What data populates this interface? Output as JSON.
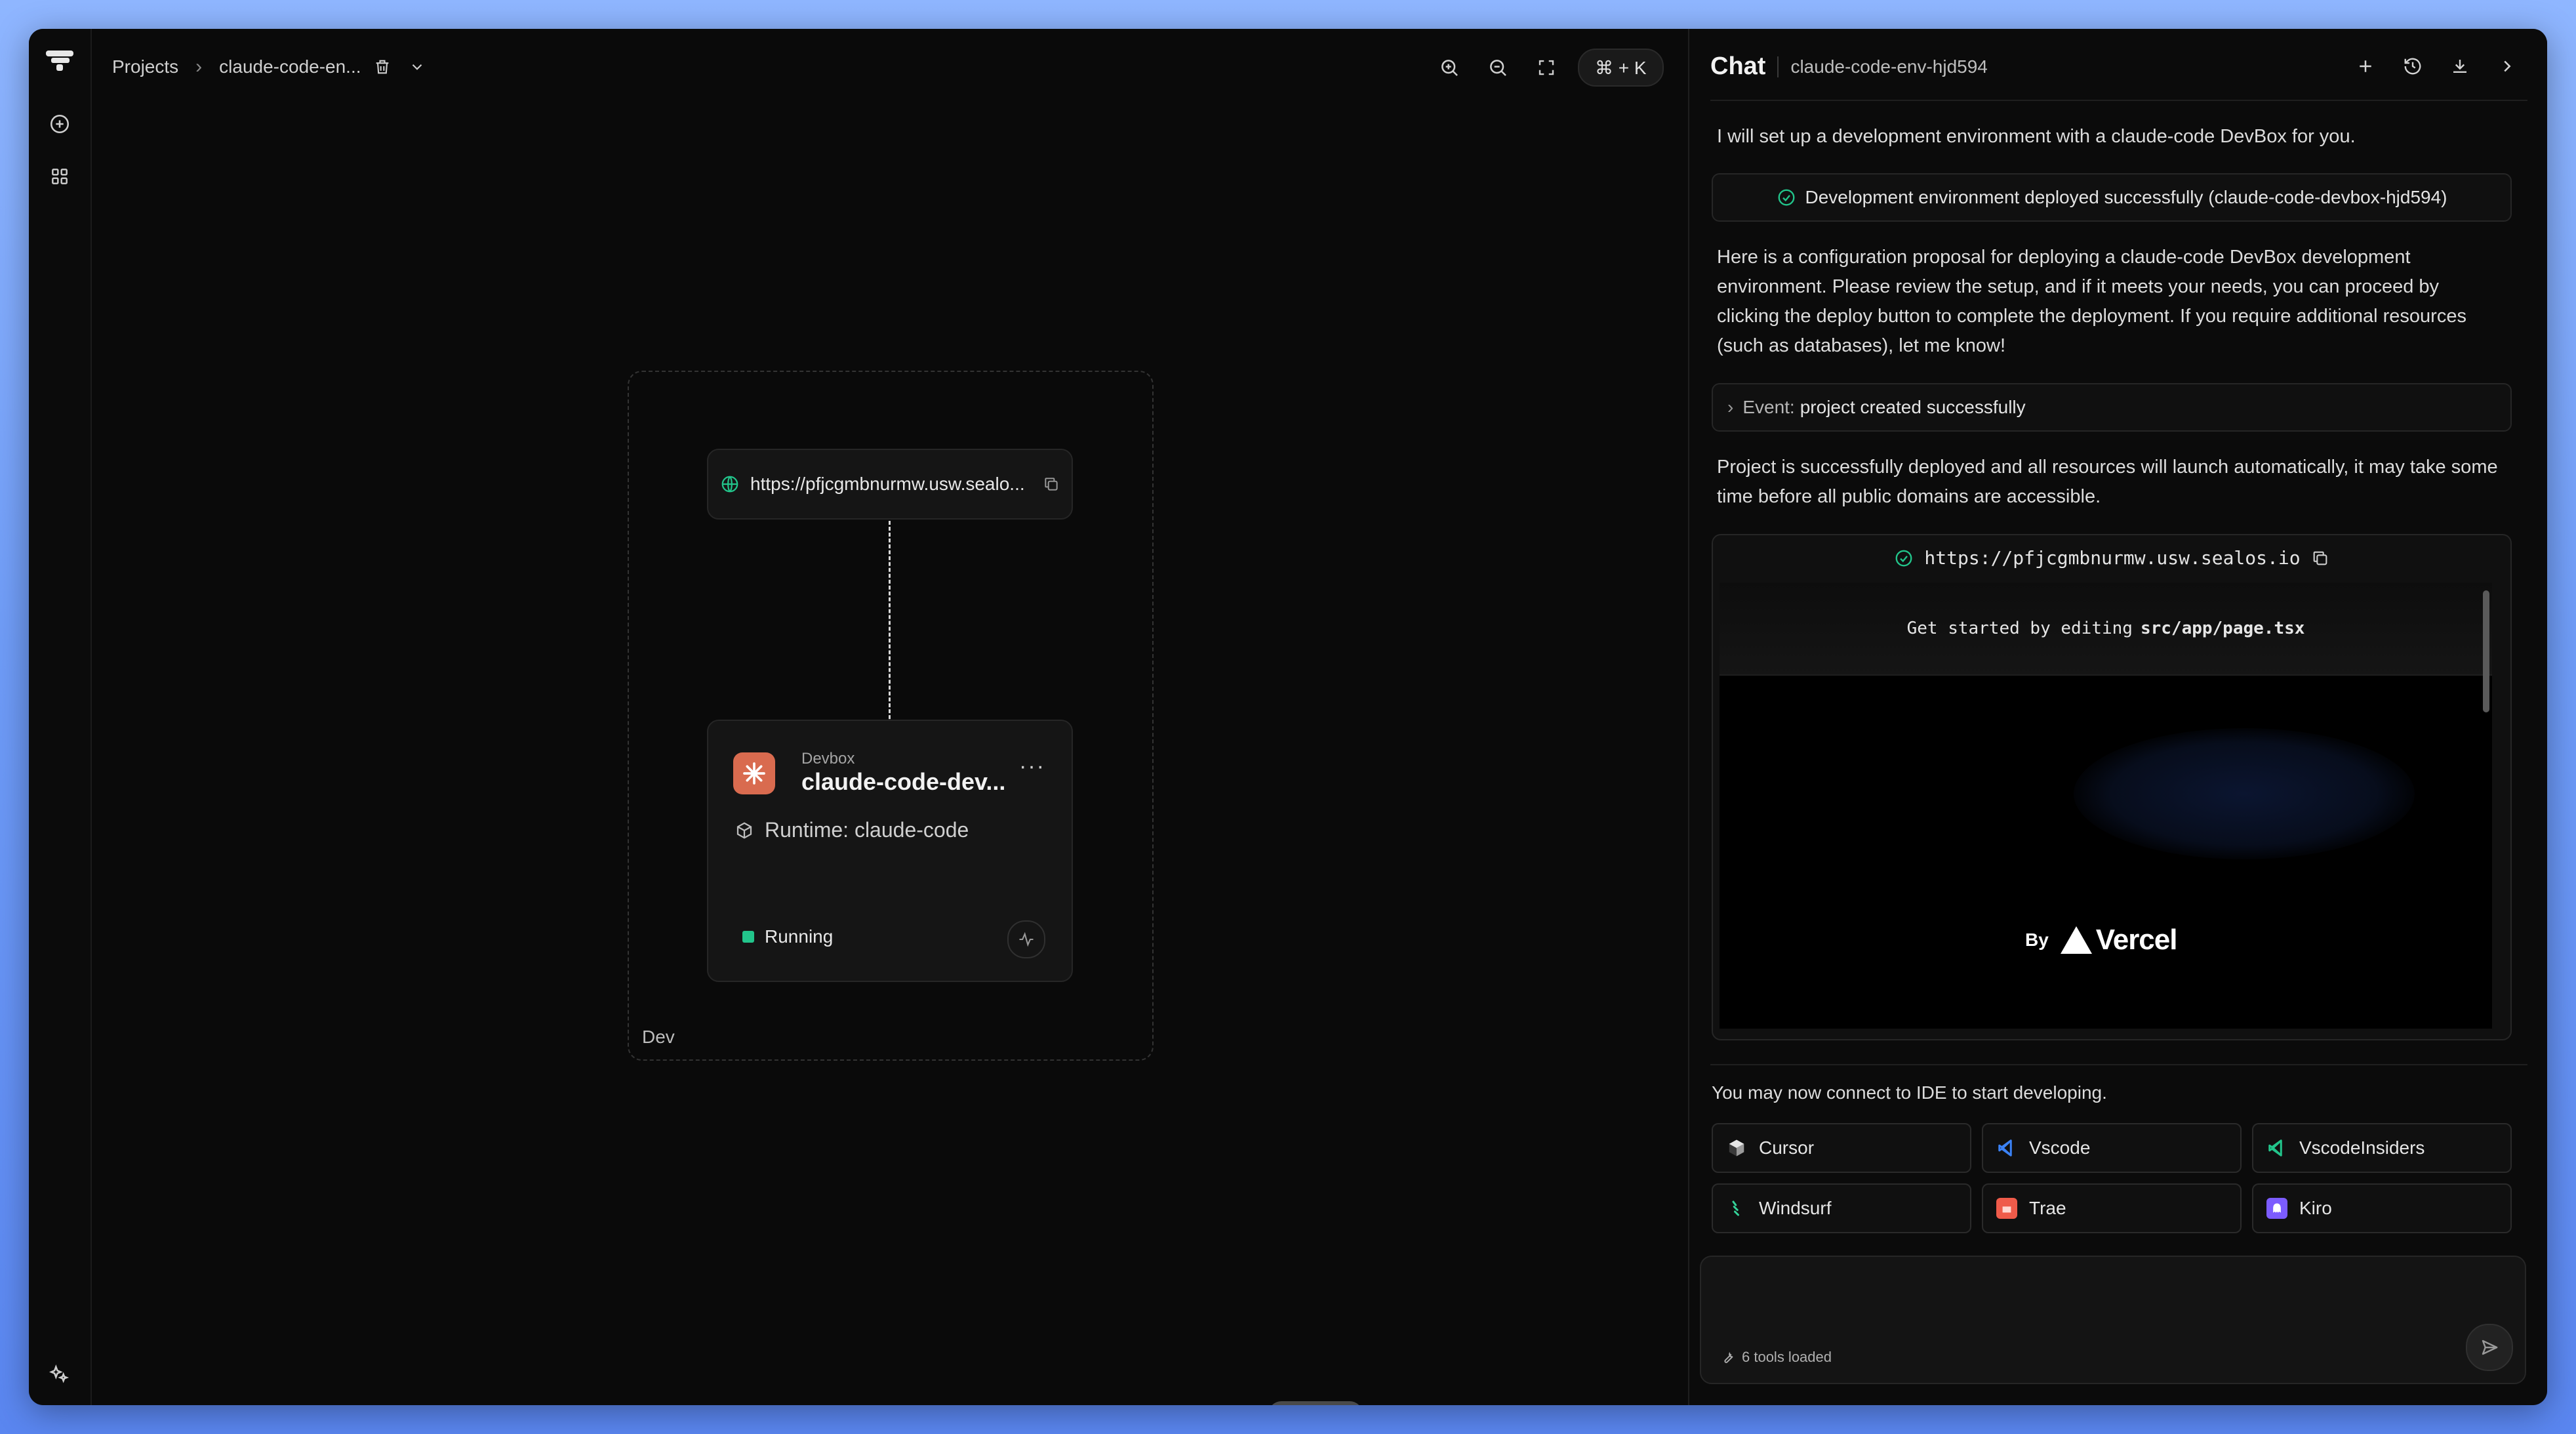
{
  "header": {
    "breadcrumb_root": "Projects",
    "breadcrumb_project": "claude-code-en...",
    "shortcut": "⌘ + K"
  },
  "canvas": {
    "group_label": "Dev",
    "url_card": {
      "url": "https://pfjcgmbnurmw.usw.sealo..."
    },
    "devbox_card": {
      "kind": "Devbox",
      "name": "claude-code-dev...",
      "runtime": "Runtime: claude-code",
      "status": "Running",
      "status_color": "#22c58b"
    }
  },
  "chat": {
    "title": "Chat",
    "session": "claude-code-env-hjd594",
    "msg_intro": "I will set up a development environment with a claude-code DevBox for you.",
    "deploy_notice": "Development environment deployed successfully (claude-code-devbox-hjd594)",
    "msg_proposal": "Here is a configuration proposal for deploying a claude-code DevBox development environment. Please review the setup, and if it meets your needs, you can proceed by clicking the deploy button to complete the deployment. If you require additional resources (such as databases), let me know!",
    "event_key": "Event:",
    "event_value": "project created successfully",
    "msg_deployed": "Project is successfully deployed and all resources will launch automatically, it may take some time before all public domains are accessible.",
    "preview": {
      "url": "https://pfjcgmbnurmw.usw.sealos.io",
      "banner_prefix": "Get started by editing",
      "banner_file": "src/app/page.tsx",
      "by_label": "By",
      "brand": "Vercel"
    },
    "ide_hint": "You may now connect to IDE to start developing.",
    "ides": [
      {
        "label": "Cursor",
        "icon": "cursor-icon",
        "color": "#d9d9d9"
      },
      {
        "label": "Vscode",
        "icon": "vscode-icon",
        "color": "#3b82f6"
      },
      {
        "label": "VscodeInsiders",
        "icon": "vscode-insiders-icon",
        "color": "#22c58b"
      },
      {
        "label": "Windsurf",
        "icon": "windsurf-icon",
        "color": "#34d399"
      },
      {
        "label": "Trae",
        "icon": "trae-icon",
        "color": "#ef5b4a"
      },
      {
        "label": "Kiro",
        "icon": "kiro-icon",
        "color": "#7c5cff"
      }
    ],
    "composer": {
      "placeholder": "",
      "tools_loaded": "6 tools loaded"
    }
  },
  "colors": {
    "accent_green": "#22c58b",
    "devbox_logo": "#d96b4f"
  }
}
